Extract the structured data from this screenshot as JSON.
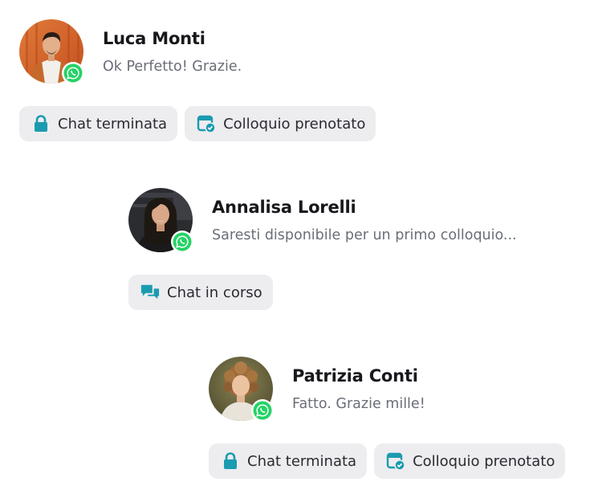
{
  "colors": {
    "accent": "#1b9bb0",
    "chip_bg": "#ededf0",
    "whatsapp": "#25d366",
    "subtext": "#6b6e78"
  },
  "conversations": [
    {
      "name": "Luca Monti",
      "message": "Ok Perfetto! Grazie.",
      "channel_icon": "whatsapp-icon",
      "chips": [
        {
          "icon": "lock-icon",
          "label": "Chat terminata"
        },
        {
          "icon": "calendar-check-icon",
          "label": "Colloquio prenotato"
        }
      ]
    },
    {
      "name": "Annalisa Lorelli",
      "message": "Saresti disponibile per un primo colloquio...",
      "channel_icon": "whatsapp-icon",
      "chips": [
        {
          "icon": "chat-bubbles-icon",
          "label": "Chat in corso"
        }
      ]
    },
    {
      "name": "Patrizia Conti",
      "message": "Fatto. Grazie mille!",
      "channel_icon": "whatsapp-icon",
      "chips": [
        {
          "icon": "lock-icon",
          "label": "Chat terminata"
        },
        {
          "icon": "calendar-check-icon",
          "label": "Colloquio prenotato"
        }
      ]
    }
  ]
}
